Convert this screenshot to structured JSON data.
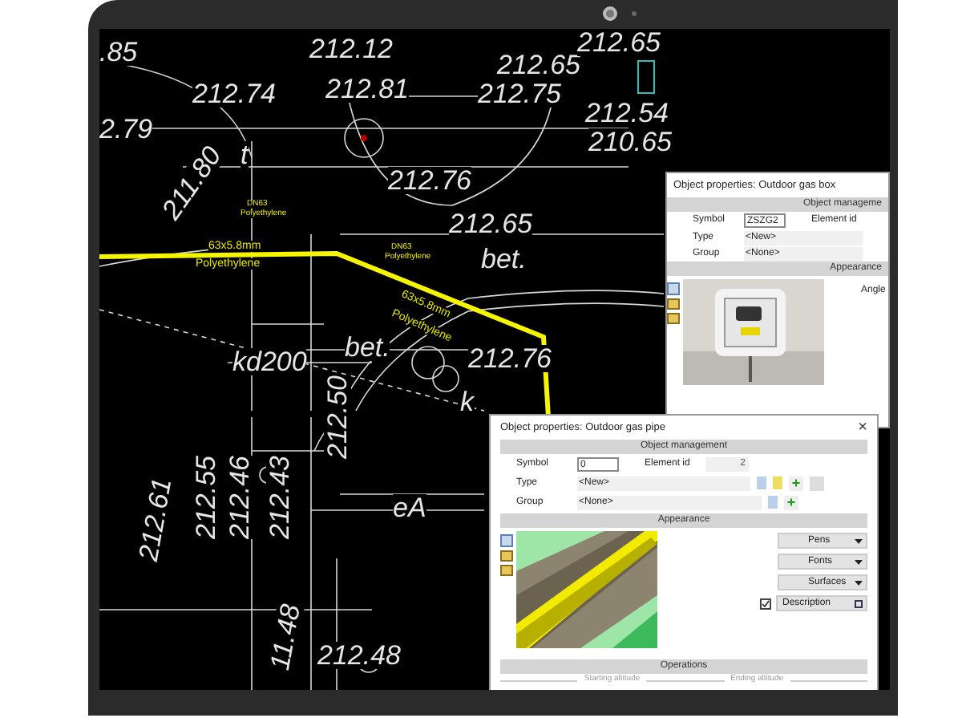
{
  "drawing_labels": [
    {
      "text": ".85",
      "kind": "elevation"
    },
    {
      "text": "212.12",
      "kind": "elevation"
    },
    {
      "text": "212.65",
      "kind": "elevation"
    },
    {
      "text": "212.65",
      "kind": "elevation"
    },
    {
      "text": "212.74",
      "kind": "elevation"
    },
    {
      "text": "212.81",
      "kind": "elevation"
    },
    {
      "text": "212.75",
      "kind": "elevation"
    },
    {
      "text": "212.54",
      "kind": "elevation"
    },
    {
      "text": "210.65",
      "kind": "elevation"
    },
    {
      "text": "2.79",
      "kind": "elevation"
    },
    {
      "text": "t",
      "kind": "elevation"
    },
    {
      "text": "212.76",
      "kind": "elevation"
    },
    {
      "text": "211.80",
      "kind": "elevation"
    },
    {
      "text": "212.65",
      "kind": "elevation"
    },
    {
      "text": "bet.",
      "kind": "elevation"
    },
    {
      "text": "bet.",
      "kind": "elevation"
    },
    {
      "text": "kd200",
      "kind": "elevation"
    },
    {
      "text": "212.76",
      "kind": "elevation"
    },
    {
      "text": "k",
      "kind": "elevation"
    },
    {
      "text": "eA",
      "kind": "elevation"
    },
    {
      "text": "212.61",
      "kind": "elevation"
    },
    {
      "text": "212.55",
      "kind": "elevation"
    },
    {
      "text": "212.46",
      "kind": "elevation"
    },
    {
      "text": "212.43",
      "kind": "elevation"
    },
    {
      "text": "212.50",
      "kind": "elevation"
    },
    {
      "text": "212.48",
      "kind": "elevation"
    },
    {
      "text": "11.48",
      "kind": "elevation"
    },
    {
      "text": "DN63",
      "kind": "pipe_tag"
    },
    {
      "text": "Polyethylene",
      "kind": "pipe_tag"
    },
    {
      "text": "63x5.8mm",
      "kind": "pipe_label"
    },
    {
      "text": "Polyethylene",
      "kind": "pipe_label"
    },
    {
      "text": "DN63",
      "kind": "pipe_tag"
    },
    {
      "text": "Polyethylene",
      "kind": "pipe_tag"
    },
    {
      "text": "63x5.8mm",
      "kind": "pipe_label"
    },
    {
      "text": "Polyethylene",
      "kind": "pipe_label"
    }
  ],
  "gas_box_window": {
    "title": "Object properties: Outdoor gas box",
    "section_1": "Object manageme",
    "symbol_label": "Symbol",
    "symbol_value": "ZSZG2",
    "element_id_label": "Element id",
    "type_label": "Type",
    "type_value": "<New>",
    "group_label": "Group",
    "group_value": "<None>",
    "section_2": "Appearance",
    "angle_label": "Angle"
  },
  "gas_pipe_window": {
    "title": "Object properties: Outdoor gas pipe",
    "close": "×",
    "section_1": "Object management",
    "symbol_label": "Symbol",
    "symbol_value": "0",
    "element_id_label": "Element id",
    "element_id_value": "2",
    "type_label": "Type",
    "type_value": "<New>",
    "group_label": "Group",
    "group_value": "<None>",
    "section_2": "Appearance",
    "add_type": "+",
    "add_group": "+",
    "buttons": [
      {
        "label": "Pens",
        "kind": "dropdown"
      },
      {
        "label": "Fonts",
        "kind": "dropdown"
      },
      {
        "label": "Surfaces",
        "kind": "dropdown"
      },
      {
        "label": "Description",
        "kind": "toggle",
        "checked": true
      }
    ],
    "section_3": "Operations",
    "starting_altitude": "Starting altitude",
    "ending_altitude": "Ending altitude"
  }
}
